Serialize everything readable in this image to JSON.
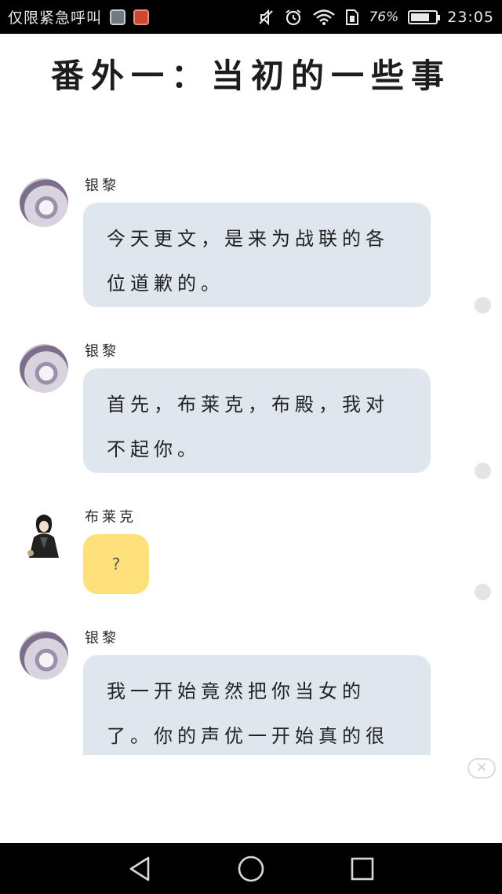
{
  "status_bar": {
    "carrier": "仅限紧急呼叫",
    "battery_percent_text": "76%",
    "battery_level": 0.76,
    "time": "23:05",
    "icons": [
      "gallery-icon",
      "app-notification-icon",
      "mute-icon",
      "alarm-icon",
      "wifi-icon",
      "sim-icon",
      "battery-icon"
    ]
  },
  "chapter_title": "番外一：当初的一些事",
  "messages": [
    {
      "sender": "银黎",
      "text": "今天更文，是来为战联的各位道歉的。",
      "avatar": "yinli-avatar"
    },
    {
      "sender": "银黎",
      "text": "首先，布莱克，布殿，我对不起你。",
      "avatar": "yinli-avatar"
    },
    {
      "sender": "布莱克",
      "text": "?",
      "avatar": "blake-avatar",
      "bubble_color": "#fde07a"
    },
    {
      "sender": "银黎",
      "text": "我一开始竟然把你当女的了。你的声优一开始真的很",
      "avatar": "yinli-avatar"
    }
  ],
  "colors": {
    "bubble": "#dfe6ee",
    "bubble_highlight": "#fde07a",
    "bars": "#000000"
  },
  "ad_close_symbol": "×",
  "nav_bar": {
    "buttons": [
      "back-icon",
      "home-icon",
      "recents-icon"
    ]
  }
}
